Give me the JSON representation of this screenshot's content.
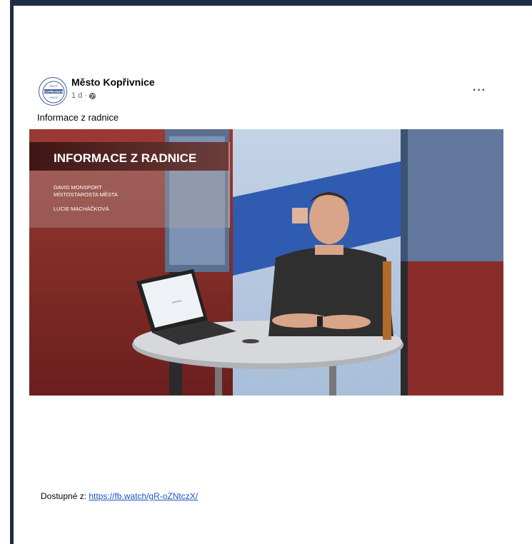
{
  "post": {
    "author": "Město Kopřivnice",
    "time": "1 d ·",
    "more_label": "···",
    "text": "Informace z radnice",
    "avatar_text": [
      "VNICE",
      "KOPŘIVNICE",
      "VNICE"
    ]
  },
  "video": {
    "title": "INFORMACE Z RADNICE",
    "lines": [
      "DAVID MONSPORT",
      "MÍSTOSTAROSTA MĚSTA",
      "LUCIE MACHÁČKOVÁ"
    ],
    "laptop_screen_text": "RADNICE"
  },
  "footer": {
    "prefix": "Dostupné z: ",
    "link": "https://fb.watch/gR-oZNtczX/"
  },
  "colors": {
    "frame": "#1f2d44",
    "link": "#1a56c8"
  }
}
